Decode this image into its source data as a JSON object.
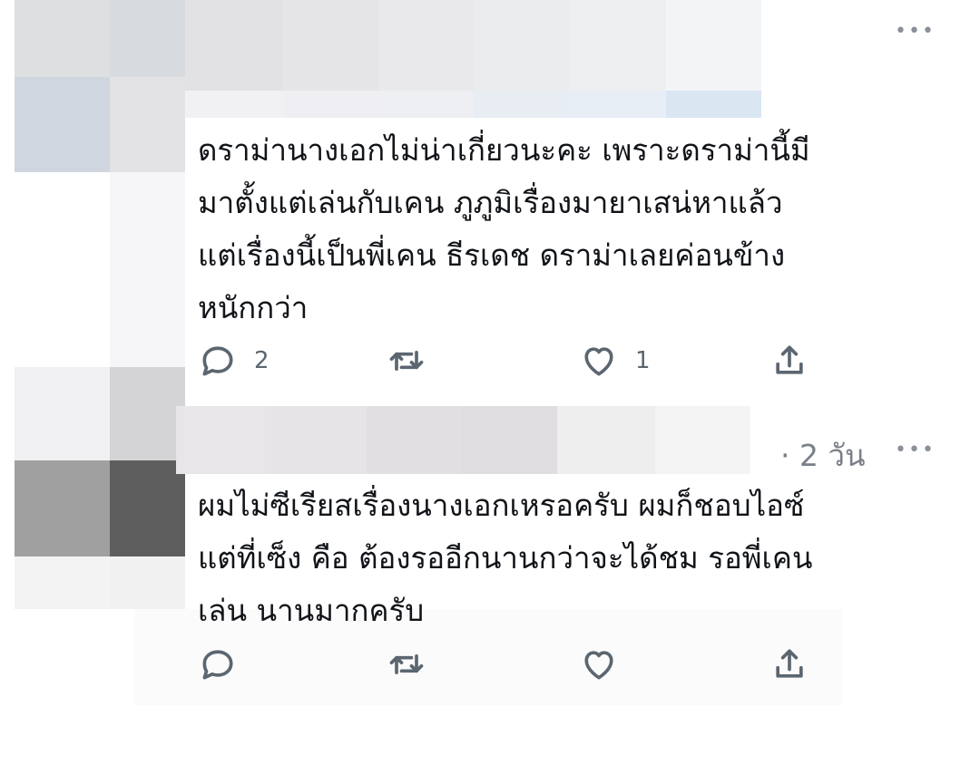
{
  "tweets": [
    {
      "text": "ดราม่านางเอกไม่น่าเกี่ยวนะคะ เพราะดราม่านี้มี\nมาตั้งแต่เล่นกับเคน ภูภูมิเรื่องมายาเสน่หาแล้ว\nแต่เรื่องนี้เป็นพี่เคน ธีรเดช ดราม่าเลยค่อนข้าง\nหนักกว่า",
      "timestamp": "",
      "reply_count": "2",
      "retweet_count": "",
      "like_count": "1"
    },
    {
      "text": "ผมไม่ซีเรียสเรื่องนางเอกเหรอครับ ผมก็ชอบไอซ์\nแต่ที่เซ็ง คือ ต้องรออีกนานกว่าจะได้ชม รอพี่เคน\nเล่น นานมากครับ",
      "timestamp": "· 2 วัน",
      "reply_count": "",
      "retweet_count": "",
      "like_count": ""
    }
  ],
  "icons": {
    "more": "more-horizontal-icon",
    "reply": "reply-bubble-icon",
    "retweet": "retweet-arrows-icon",
    "like": "heart-icon",
    "share": "share-upload-icon"
  },
  "colors": {
    "text": "#111418",
    "muted": "#5b6670",
    "background": "#ffffff"
  }
}
